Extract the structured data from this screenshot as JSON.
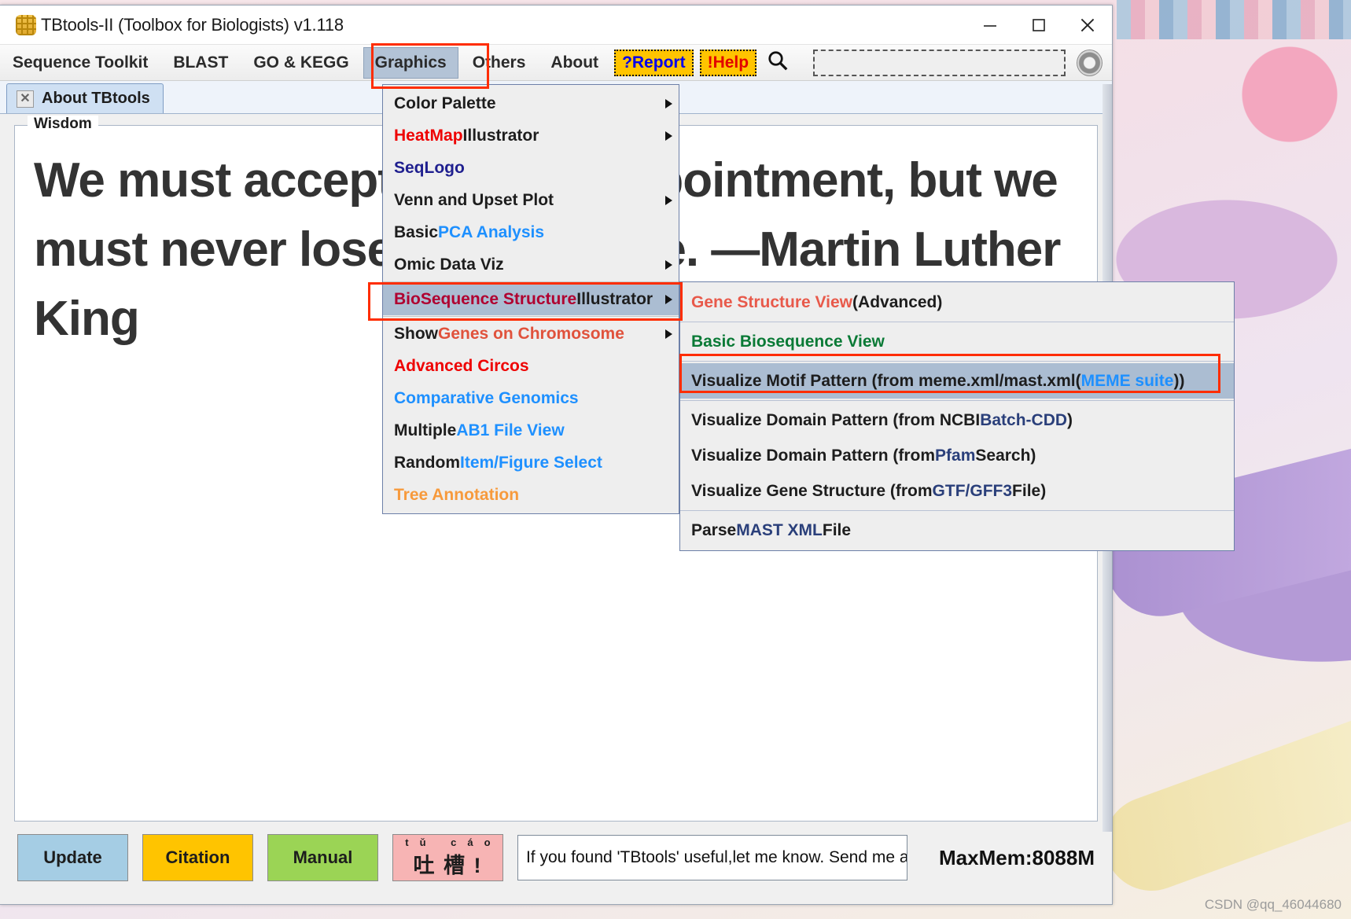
{
  "window": {
    "title": "TBtools-II (Toolbox for Biologists) v1.118",
    "icon": "grid-app-icon",
    "minimize_label": "─",
    "maximize_label": "□",
    "close_label": "✕"
  },
  "menubar": {
    "items": [
      {
        "label": "Sequence Toolkit",
        "name": "menu-sequence-toolkit"
      },
      {
        "label": "BLAST",
        "name": "menu-blast"
      },
      {
        "label": "GO & KEGG",
        "name": "menu-go-kegg"
      },
      {
        "label": "Graphics",
        "name": "menu-graphics",
        "active": true
      },
      {
        "label": "Others",
        "name": "menu-others"
      },
      {
        "label": "About",
        "name": "menu-about"
      }
    ],
    "report_badge": {
      "mark": "?",
      "word": "Report"
    },
    "help_badge": {
      "mark": "!",
      "word": "Help"
    },
    "search_placeholder": "",
    "search_value": ""
  },
  "tabs": [
    {
      "label": "About TBtools",
      "close": "✕"
    }
  ],
  "wisdom": {
    "legend": "Wisdom",
    "quote": "We must accept finite disappointment, but we must never lose infinite hope. —Martin Luther King"
  },
  "graphics_menu": {
    "items": [
      {
        "name": "color-palette",
        "arrow": true,
        "parts": [
          {
            "t": "Color Palette",
            "c": "dark"
          }
        ]
      },
      {
        "name": "heatmap-illustrator",
        "arrow": true,
        "parts": [
          {
            "t": "HeatMap",
            "c": "red"
          },
          {
            "t": " Illustrator",
            "c": "dark"
          }
        ]
      },
      {
        "name": "seqlogo",
        "arrow": false,
        "parts": [
          {
            "t": "SeqLogo",
            "c": "navy"
          }
        ]
      },
      {
        "name": "venn-and-upset-plot",
        "arrow": true,
        "parts": [
          {
            "t": "Venn and Upset Plot",
            "c": "dark"
          }
        ]
      },
      {
        "name": "basic-pca-analysis",
        "arrow": false,
        "parts": [
          {
            "t": "Basic ",
            "c": "dark"
          },
          {
            "t": "PCA Analysis",
            "c": "blue"
          }
        ]
      },
      {
        "name": "omic-data-viz",
        "arrow": true,
        "parts": [
          {
            "t": "Omic Data Viz",
            "c": "dark"
          }
        ]
      },
      {
        "name": "biosequence-structure-illustrator",
        "arrow": true,
        "selected": true,
        "parts": [
          {
            "t": "BioSequence Structure",
            "c": "crimson"
          },
          {
            "t": " Illustrator",
            "c": "dark"
          }
        ]
      },
      {
        "name": "show-genes-on-chromosome",
        "arrow": true,
        "parts": [
          {
            "t": "Show ",
            "c": "dark"
          },
          {
            "t": "Genes on Chromosome",
            "c": "tomato"
          }
        ]
      },
      {
        "name": "advanced-circos",
        "arrow": false,
        "parts": [
          {
            "t": "Advanced Circos",
            "c": "red"
          }
        ]
      },
      {
        "name": "comparative-genomics",
        "arrow": false,
        "parts": [
          {
            "t": "Comparative Genomics",
            "c": "blue"
          }
        ]
      },
      {
        "name": "multiple-ab1-file-view",
        "arrow": false,
        "parts": [
          {
            "t": "Multiple ",
            "c": "dark"
          },
          {
            "t": "AB1 File View",
            "c": "blue"
          }
        ]
      },
      {
        "name": "random-item-figure-select",
        "arrow": false,
        "parts": [
          {
            "t": "Random ",
            "c": "dark"
          },
          {
            "t": "Item/Figure Select",
            "c": "blue"
          }
        ]
      },
      {
        "name": "tree-annotation",
        "arrow": false,
        "parts": [
          {
            "t": "Tree Annotation",
            "c": "orange"
          }
        ]
      }
    ]
  },
  "sub_menu": {
    "items": [
      {
        "name": "gene-structure-view-advanced",
        "parts": [
          {
            "t": "Gene Structure View",
            "c": "salmon"
          },
          {
            "t": " (Advanced)",
            "c": "dark"
          }
        ]
      },
      {
        "name": "basic-biosequence-view",
        "parts": [
          {
            "t": "Basic Biosequence View",
            "c": "green"
          }
        ]
      },
      {
        "name": "visualize-motif-pattern",
        "selected": true,
        "parts": [
          {
            "t": "Visualize Motif Pattern (from meme.xml/mast.xml(",
            "c": "dark"
          },
          {
            "t": "MEME suite",
            "c": "blue"
          },
          {
            "t": "))",
            "c": "dark"
          }
        ]
      },
      {
        "name": "visualize-domain-pattern-ncbi-batch-cdd",
        "parts": [
          {
            "t": "Visualize Domain Pattern (from NCBI ",
            "c": "dark"
          },
          {
            "t": "Batch-CDD",
            "c": "dkblue"
          },
          {
            "t": ")",
            "c": "dark"
          }
        ]
      },
      {
        "name": "visualize-domain-pattern-pfam-search",
        "parts": [
          {
            "t": "Visualize Domain Pattern (from ",
            "c": "dark"
          },
          {
            "t": "Pfam",
            "c": "dkblue"
          },
          {
            "t": " Search)",
            "c": "dark"
          }
        ]
      },
      {
        "name": "visualize-gene-structure-gtf-gff3",
        "parts": [
          {
            "t": "Visualize Gene Structure (from ",
            "c": "dark"
          },
          {
            "t": "GTF/GFF3",
            "c": "dkblue"
          },
          {
            "t": " File)",
            "c": "dark"
          }
        ]
      },
      {
        "name": "parse-mast-xml-file",
        "parts": [
          {
            "t": "Parse ",
            "c": "dark"
          },
          {
            "t": "MAST XML",
            "c": "dkblue"
          },
          {
            "t": " File",
            "c": "dark"
          }
        ]
      }
    ]
  },
  "bottom": {
    "update_label": "Update",
    "citation_label": "Citation",
    "manual_label": "Manual",
    "tucao_pinyin": "tǔ cáo",
    "tucao_hanzi": "吐 槽 !",
    "message_value": "If you found 'TBtools' useful,let me know. Send me a",
    "maxmem": "MaxMem:8088M"
  },
  "watermark": "CSDN @qq_46044680",
  "colors": {
    "accent_selected": "#abbdd2",
    "annotation_red": "#ff2d00",
    "badge_yellow": "#ffc400",
    "update_blue": "#a5cde4",
    "manual_green": "#9bd455",
    "tucao_pink": "#f7b4b4"
  }
}
